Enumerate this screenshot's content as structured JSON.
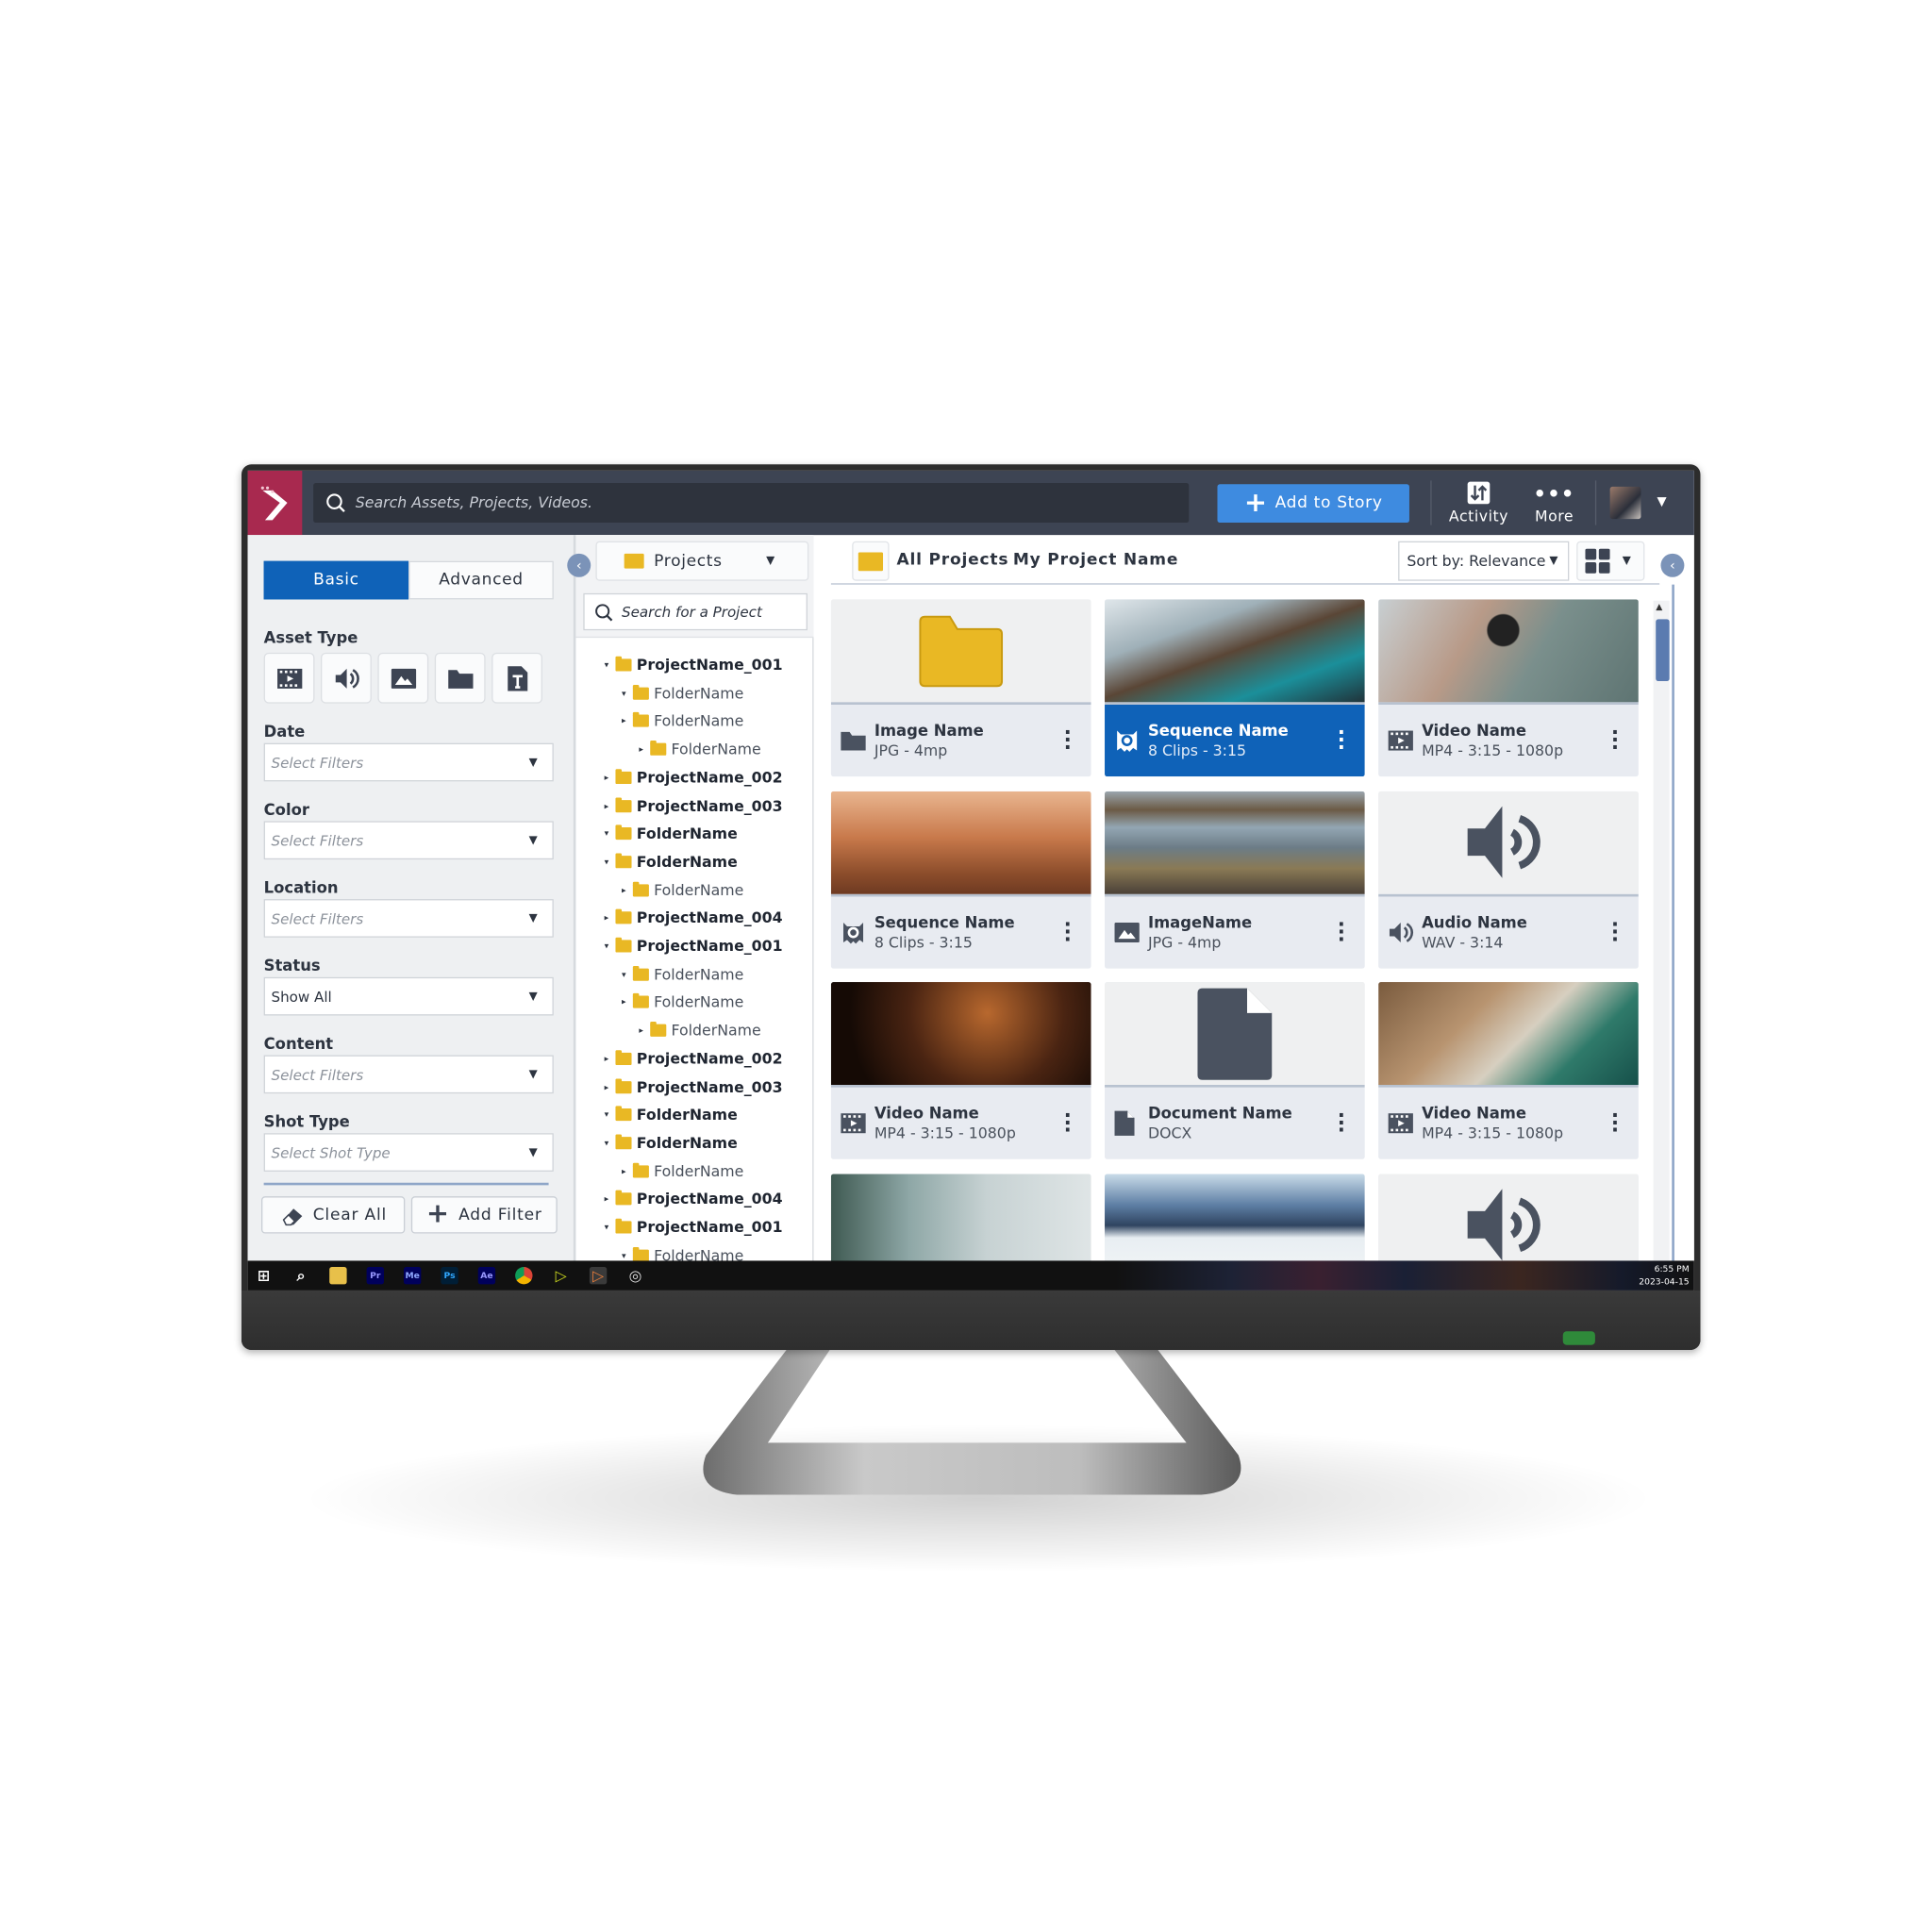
{
  "colors": {
    "accent": "#0f62b8",
    "add_button": "#3e8be0",
    "topbar": "#3d4453",
    "logo": "#a8294f",
    "folder": "#e9b824",
    "icon": "#4a5260"
  },
  "topbar": {
    "search_placeholder": "Search Assets, Projects, Videos.",
    "add_to_story": "Add to Story",
    "activity": "Activity",
    "more": "More"
  },
  "filters": {
    "tabs": [
      "Basic",
      "Advanced"
    ],
    "active_tab": "Basic",
    "asset_type_label": "Asset Type",
    "asset_types": [
      "video-icon",
      "audio-icon",
      "image-icon",
      "folder-icon",
      "document-text-icon"
    ],
    "groups": [
      {
        "label": "Date",
        "value": "Select Filters",
        "placeholder": true
      },
      {
        "label": "Color",
        "value": "Select Filters",
        "placeholder": true
      },
      {
        "label": "Location",
        "value": "Select Filters",
        "placeholder": true
      },
      {
        "label": "Status",
        "value": "Show All",
        "placeholder": false
      },
      {
        "label": "Content",
        "value": "Select Filters",
        "placeholder": true
      },
      {
        "label": "Shot Type",
        "value": "Select Shot Type",
        "placeholder": true
      }
    ],
    "clear_all": "Clear All",
    "add_filter": "Add Filter"
  },
  "tree": {
    "dropdown": "Projects",
    "search_placeholder": "Search for a Project",
    "items": [
      {
        "label": "ProjectName_001",
        "level": 0,
        "open": true
      },
      {
        "label": "FolderName",
        "level": 1,
        "open": true
      },
      {
        "label": "FolderName",
        "level": 1,
        "open": false
      },
      {
        "label": "FolderName",
        "level": 2,
        "open": false
      },
      {
        "label": "ProjectName_002",
        "level": 0,
        "open": false
      },
      {
        "label": "ProjectName_003",
        "level": 0,
        "open": false
      },
      {
        "label": "FolderName",
        "level": 0,
        "open": true
      },
      {
        "label": "FolderName",
        "level": 0,
        "open": true
      },
      {
        "label": "FolderName",
        "level": 1,
        "open": false
      },
      {
        "label": "ProjectName_004",
        "level": 0,
        "open": false
      },
      {
        "label": "ProjectName_001",
        "level": 0,
        "open": true
      },
      {
        "label": "FolderName",
        "level": 1,
        "open": true
      },
      {
        "label": "FolderName",
        "level": 1,
        "open": false
      },
      {
        "label": "FolderName",
        "level": 2,
        "open": false
      },
      {
        "label": "ProjectName_002",
        "level": 0,
        "open": false
      },
      {
        "label": "ProjectName_003",
        "level": 0,
        "open": false
      },
      {
        "label": "FolderName",
        "level": 0,
        "open": true
      },
      {
        "label": "FolderName",
        "level": 0,
        "open": true
      },
      {
        "label": "FolderName",
        "level": 1,
        "open": false
      },
      {
        "label": "ProjectName_004",
        "level": 0,
        "open": false
      },
      {
        "label": "ProjectName_001",
        "level": 0,
        "open": true
      },
      {
        "label": "FolderName",
        "level": 1,
        "open": true
      }
    ]
  },
  "main": {
    "breadcrumb": [
      "All Projects",
      "My Project Name"
    ],
    "sort": "Sort by: Relevance",
    "view": "grid-icon",
    "cards": [
      {
        "name": "Image Name",
        "meta": "JPG - 4mp",
        "icon": "folder-icon",
        "thumb": "folder",
        "selected": false
      },
      {
        "name": "Sequence Name",
        "meta": "8 Clips - 3:15",
        "icon": "sequence-icon",
        "thumb": "photo-ski",
        "selected": true
      },
      {
        "name": "Video Name",
        "meta": "MP4 - 3:15 - 1080p",
        "icon": "video-icon",
        "thumb": "photo-camera",
        "selected": false
      },
      {
        "name": "Sequence Name",
        "meta": "8 Clips - 3:15",
        "icon": "sequence-icon",
        "thumb": "photo-beach",
        "selected": false
      },
      {
        "name": "ImageName",
        "meta": "JPG - 4mp",
        "icon": "image-icon",
        "thumb": "photo-lake",
        "selected": false
      },
      {
        "name": "Audio Name",
        "meta": "WAV - 3:14",
        "icon": "audio-icon",
        "thumb": "audio",
        "selected": false
      },
      {
        "name": "Video Name",
        "meta": "MP4 - 3:15 - 1080p",
        "icon": "video-icon",
        "thumb": "photo-chair",
        "selected": false
      },
      {
        "name": "Document Name",
        "meta": "DOCX",
        "icon": "document-icon",
        "thumb": "document",
        "selected": false
      },
      {
        "name": "Video Name",
        "meta": "MP4 - 3:15 - 1080p",
        "icon": "video-icon",
        "thumb": "photo-coast",
        "selected": false
      },
      {
        "thumb": "photo-fog",
        "selected": false
      },
      {
        "thumb": "photo-snow",
        "selected": false
      },
      {
        "thumb": "audio",
        "selected": false
      }
    ]
  },
  "taskbar": {
    "apps": [
      "windows-start-icon",
      "search-icon",
      "file-explorer-icon",
      "premiere-icon",
      "media-encoder-icon",
      "photoshop-icon",
      "after-effects-icon",
      "chrome-icon",
      "app-icon",
      "active-app-icon",
      "obs-icon"
    ],
    "app_labels": {
      "premiere": "Pr",
      "media_encoder": "Me",
      "photoshop": "Ps",
      "after_effects": "Ae"
    },
    "time": "6:55 PM",
    "date": "2023-04-15"
  }
}
